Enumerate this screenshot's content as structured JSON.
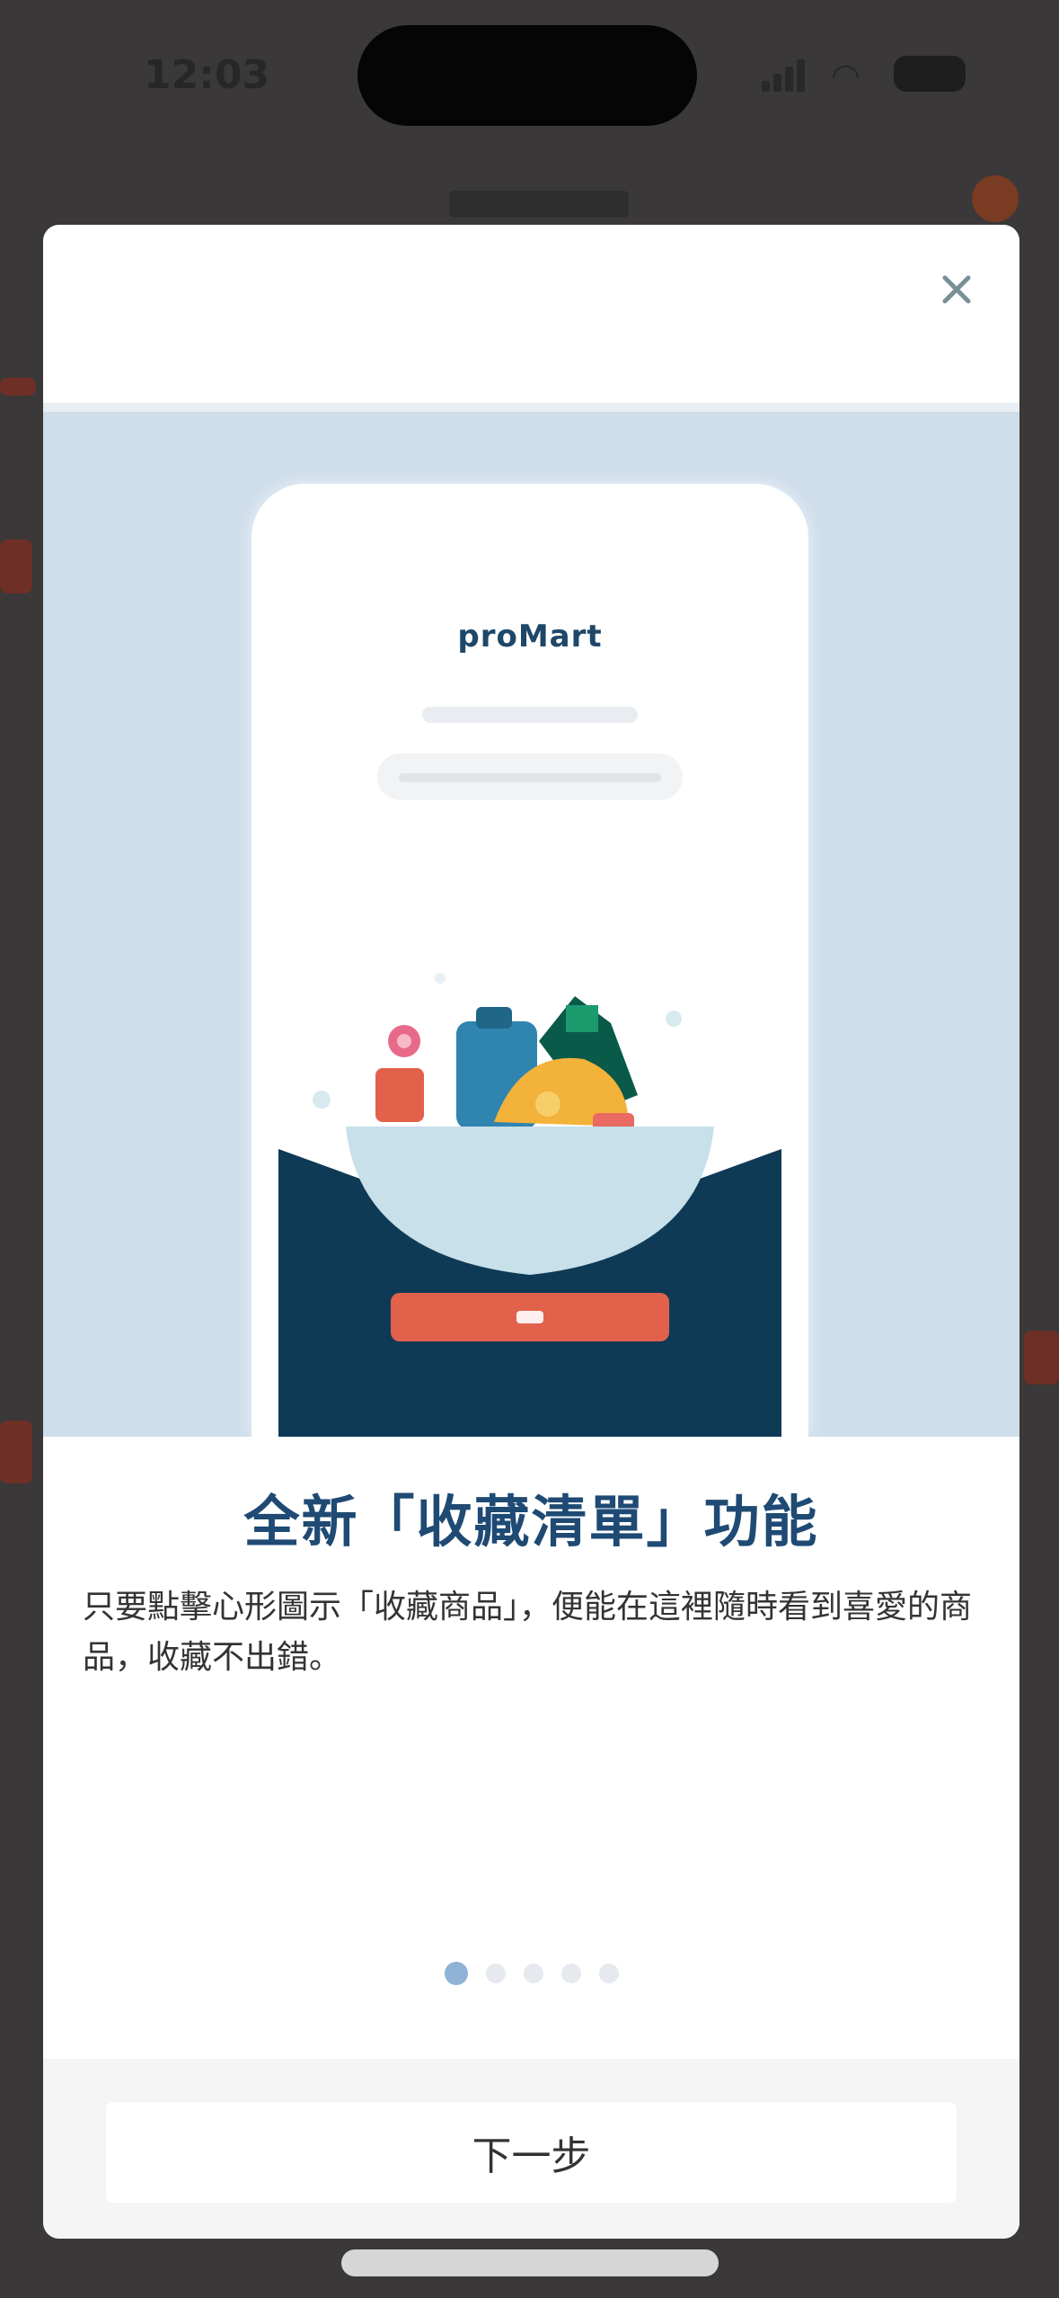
{
  "status_bar": {
    "time": "12:03",
    "wifi_icon": "wifi-icon",
    "battery_icon": "battery-icon"
  },
  "modal": {
    "close_icon": "close-icon",
    "illustration": {
      "brand": "proMart",
      "colors": {
        "background": "#cfdeeb",
        "navy": "#0f3a56",
        "bowl": "#c7e0ea",
        "cta": "#e2614b"
      }
    },
    "title": "全新「收藏清單」功能",
    "description": "只要點擊心形圖示「收藏商品」，便能在這裡隨時看到喜愛的商品，收藏不出錯。",
    "pager": {
      "count": 5,
      "active": 0
    },
    "next_label": "下一步"
  }
}
